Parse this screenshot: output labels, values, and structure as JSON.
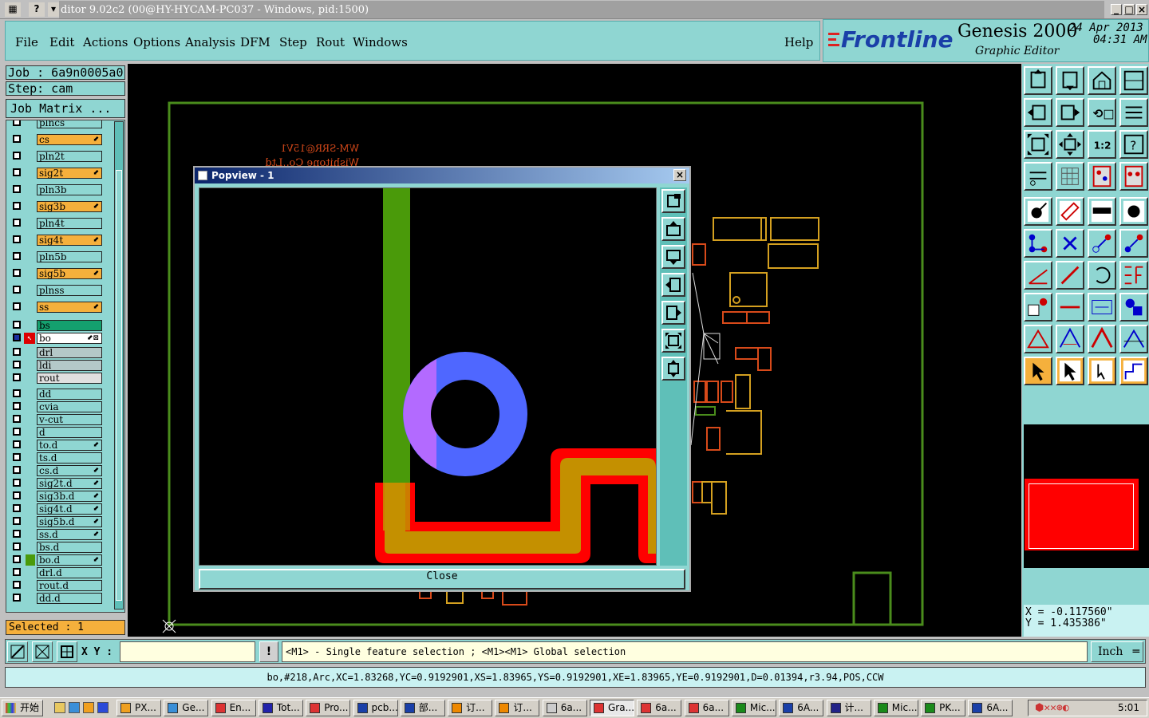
{
  "window": {
    "title": "ditor 9.02c2 (00@HY-HYCAM-PC037 - Windows, pid:1500)",
    "min": "_",
    "max": "□",
    "close": "×"
  },
  "menu": [
    "File",
    "Edit",
    "Actions",
    "Options",
    "Analysis",
    "DFM",
    "Step",
    "Rout",
    "Windows"
  ],
  "help": "Help",
  "brand": {
    "logo": "Frontline",
    "product": "Genesis 2000",
    "subtitle": "Graphic Editor",
    "date": "24 Apr 2013",
    "time": "04:31 AM"
  },
  "job": {
    "job": "Job  :  6a9n0005a0",
    "step": "Step:  cam",
    "matrix": "Job Matrix ..."
  },
  "layers": [
    {
      "name": "plncs",
      "color": "#8fd6d2"
    },
    {
      "name": "cs",
      "color": "#f5b03c",
      "mark": "⬋"
    },
    {
      "name": "pln2t",
      "color": "#8fd6d2"
    },
    {
      "name": "sig2t",
      "color": "#f5b03c",
      "mark": "⬋"
    },
    {
      "name": "pln3b",
      "color": "#8fd6d2"
    },
    {
      "name": "sig3b",
      "color": "#f5b03c",
      "mark": "⬋"
    },
    {
      "name": "pln4t",
      "color": "#8fd6d2"
    },
    {
      "name": "sig4t",
      "color": "#f5b03c",
      "mark": "⬋"
    },
    {
      "name": "pln5b",
      "color": "#8fd6d2"
    },
    {
      "name": "sig5b",
      "color": "#f5b03c",
      "mark": "⬋"
    },
    {
      "name": "plnss",
      "color": "#8fd6d2"
    },
    {
      "name": "ss",
      "color": "#f5b03c",
      "mark": "⬋"
    },
    {
      "name": "bs",
      "color": "#14a06e"
    },
    {
      "name": "bo",
      "color": "#ffffff",
      "mark": "⬋⊠"
    },
    {
      "name": "drl",
      "color": "#b4c8c8"
    },
    {
      "name": "ldi",
      "color": "#b4c8c8"
    },
    {
      "name": "rout",
      "color": "#e0e0e0"
    },
    {
      "name": "dd",
      "color": "#8fd6d2"
    },
    {
      "name": "cvia",
      "color": "#8fd6d2"
    },
    {
      "name": "v-cut",
      "color": "#8fd6d2"
    },
    {
      "name": "d",
      "color": "#8fd6d2"
    },
    {
      "name": "to.d",
      "color": "#8fd6d2",
      "mark": "⬋"
    },
    {
      "name": "ts.d",
      "color": "#8fd6d2"
    },
    {
      "name": "cs.d",
      "color": "#8fd6d2",
      "mark": "⬋"
    },
    {
      "name": "sig2t.d",
      "color": "#8fd6d2",
      "mark": "⬋"
    },
    {
      "name": "sig3b.d",
      "color": "#8fd6d2",
      "mark": "⬋"
    },
    {
      "name": "sig4t.d",
      "color": "#8fd6d2",
      "mark": "⬋"
    },
    {
      "name": "sig5b.d",
      "color": "#8fd6d2",
      "mark": "⬋"
    },
    {
      "name": "ss.d",
      "color": "#8fd6d2",
      "mark": "⬋"
    },
    {
      "name": "bs.d",
      "color": "#8fd6d2"
    },
    {
      "name": "bo.d",
      "color": "#8fd6d2",
      "mark": "⬋"
    },
    {
      "name": "drl.d",
      "color": "#8fd6d2"
    },
    {
      "name": "rout.d",
      "color": "#8fd6d2"
    },
    {
      "name": "dd.d",
      "color": "#8fd6d2"
    }
  ],
  "selected": "Selected : 1",
  "canvas_text": {
    "line1": "WM-SRR@15V1",
    "line2": "Wishitone Co.,Ltd"
  },
  "popup": {
    "title": "Popview - 1",
    "close_label": "Close"
  },
  "coords": {
    "x": "X  =  -0.117560\"",
    "y": "Y  =  1.435386\""
  },
  "cmd": {
    "xy_label": "X Y :",
    "xy_value": "",
    "hint": "<M1> - Single feature selection ; <M1><M1> Global selection",
    "unit": "Inch"
  },
  "status": "bo,#218,Arc,XC=1.83268,YC=0.9192901,XS=1.83965,YS=0.9192901,XE=1.83965,YE=0.9192901,D=0.01394,r3.94,POS,CCW",
  "taskbar": {
    "start": "开始",
    "clock": "5:01",
    "tasks": [
      "PX...",
      "Ge...",
      "En...",
      "Tot...",
      "Pro...",
      "pcb...",
      "部...",
      "订...",
      "订...",
      "6a...",
      "Gra...",
      "6a...",
      "6a...",
      "Mic...",
      "6A...",
      "计...",
      "Mic...",
      "PK...",
      "6A..."
    ]
  }
}
